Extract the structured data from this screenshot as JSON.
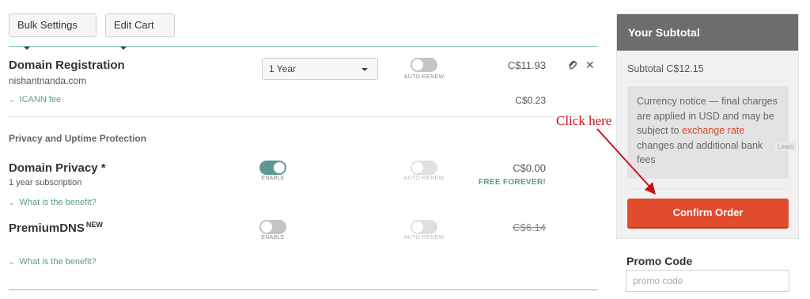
{
  "toolbar": {
    "bulk_settings_label": "Bulk Settings",
    "edit_cart_label": "Edit Cart"
  },
  "domain_registration": {
    "title": "Domain Registration",
    "domain": "nishantnanda.com",
    "period_selected": "1 Year",
    "auto_renew_caption": "AUTO-RENEW",
    "price": "C$11.93",
    "icann_label": "ICANN fee",
    "icann_price": "C$0.23"
  },
  "privacy_section": {
    "heading": "Privacy and Uptime Protection"
  },
  "domain_privacy": {
    "title": "Domain Privacy *",
    "subtitle": "1 year subscription",
    "enable_caption": "ENABLE",
    "auto_renew_caption": "AUTO-RENEW",
    "price": "C$0.00",
    "free_label": "FREE FOREVER!",
    "benefit_link": "What is the benefit?"
  },
  "premium_dns": {
    "title": "PremiumDNS",
    "badge": "NEW",
    "enable_caption": "ENABLE",
    "auto_renew_caption": "AUTO-RENEW",
    "price": "C$6.14",
    "benefit_link": "What is the benefit?"
  },
  "subtotal_panel": {
    "heading": "Your Subtotal",
    "subtotal_text": "Subtotal C$12.15",
    "notice_part1": "Currency notice — final charges are applied in USD and may be subject to ",
    "notice_link": "exchange rate",
    "notice_part2": " changes and additional bank fees",
    "side_tag": "Learn",
    "confirm_label": "Confirm Order",
    "promo_label": "Promo Code",
    "promo_placeholder": "promo code"
  },
  "annotation": {
    "text": "Click here"
  },
  "colors": {
    "accent_teal": "#5a9a92",
    "confirm_orange": "#e14b2e",
    "annotation_red": "#c8121a"
  },
  "icons": {
    "attach": "paperclip-icon",
    "remove": "close-icon",
    "expand": "chevron-down-icon",
    "dropdown": "caret-down-icon"
  }
}
